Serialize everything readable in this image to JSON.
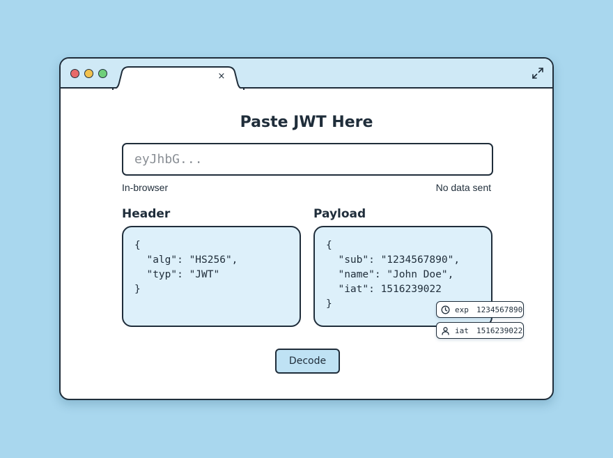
{
  "browser": {
    "tab_close_label": "×"
  },
  "page": {
    "title": "Paste JWT Here",
    "input_placeholder": "eyJhbG...",
    "note_left": "In-browser",
    "note_right": "No data sent"
  },
  "header_section": {
    "label": "Header",
    "lines": [
      "{",
      "  \"alg\": \"HS256\",",
      "  \"typ\": \"JWT\"",
      "}"
    ]
  },
  "payload_section": {
    "label": "Payload",
    "lines": [
      "{",
      "  \"sub\": \"1234567890\",",
      "  \"name\": \"John Doe\",",
      "  \"iat\": 1516239022",
      "}"
    ]
  },
  "claims": [
    {
      "key": "exp",
      "value": "1234567890",
      "icon": "clock-icon"
    },
    {
      "key": "iat",
      "value": "1516239022",
      "icon": "user-icon"
    }
  ],
  "actions": {
    "decode_label": "Decode"
  },
  "colors": {
    "background": "#a9d7ee",
    "titlebar": "#cfe9f6",
    "code_box": "#ddf0fa",
    "button": "#bfe2f4",
    "outline": "#1f2d3a"
  }
}
